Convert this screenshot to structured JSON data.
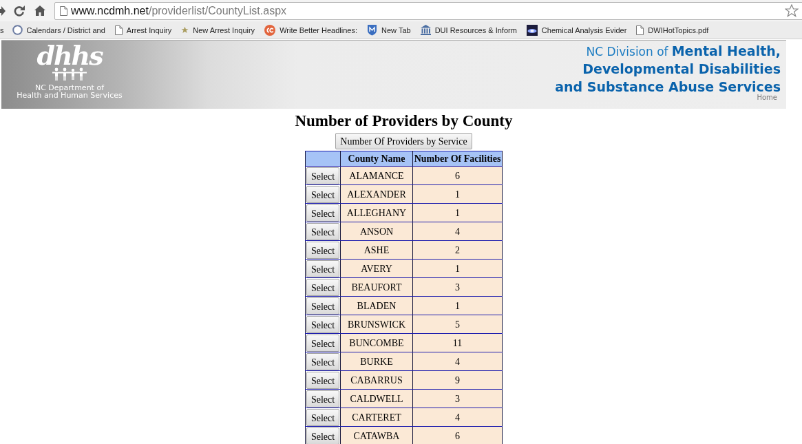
{
  "browser": {
    "address_bar": {
      "domain": "www.ncdmh.net",
      "path": "/providerlist/CountyList.aspx"
    },
    "bookmarks": [
      {
        "label": "s",
        "kind": "text"
      },
      {
        "label": "Calendars / District and",
        "kind": "ring"
      },
      {
        "label": "Arrest Inquiry",
        "kind": "page"
      },
      {
        "label": "New Arrest Inquiry",
        "kind": "star"
      },
      {
        "label": "Write Better Headlines:",
        "kind": "disc"
      },
      {
        "label": "New Tab",
        "kind": "shield"
      },
      {
        "label": "DUI Resources & Inform",
        "kind": "building"
      },
      {
        "label": "Chemical Analysis Evider",
        "kind": "image"
      },
      {
        "label": "DWIHotTopics.pdf",
        "kind": "page"
      }
    ]
  },
  "banner": {
    "logo": {
      "wordmark": "dhhs",
      "caption": [
        "NC Department of",
        "Health and Human Services"
      ]
    },
    "division": {
      "prefix": "NC Division of",
      "lines": [
        "Mental Health,",
        "Developmental Disabilities",
        "and Substance Abuse Services"
      ]
    },
    "home_link": "Home"
  },
  "page": {
    "title": "Number of Providers by County",
    "service_button": "Number Of Providers by Service"
  },
  "table": {
    "columns": [
      "County Name",
      "Number Of Facilities"
    ],
    "rows": [
      {
        "action": "Select",
        "county": "ALAMANCE",
        "facilities": "6"
      },
      {
        "action": "Select",
        "county": "ALEXANDER",
        "facilities": "1"
      },
      {
        "action": "Select",
        "county": "ALLEGHANY",
        "facilities": "1"
      },
      {
        "action": "Select",
        "county": "ANSON",
        "facilities": "4"
      },
      {
        "action": "Select",
        "county": "ASHE",
        "facilities": "2"
      },
      {
        "action": "Select",
        "county": "AVERY",
        "facilities": "1"
      },
      {
        "action": "Select",
        "county": "BEAUFORT",
        "facilities": "3"
      },
      {
        "action": "Select",
        "county": "BLADEN",
        "facilities": "1"
      },
      {
        "action": "Select",
        "county": "BRUNSWICK",
        "facilities": "5"
      },
      {
        "action": "Select",
        "county": "BUNCOMBE",
        "facilities": "11"
      },
      {
        "action": "Select",
        "county": "BURKE",
        "facilities": "4"
      },
      {
        "action": "Select",
        "county": "CABARRUS",
        "facilities": "9"
      },
      {
        "action": "Select",
        "county": "CALDWELL",
        "facilities": "3"
      },
      {
        "action": "Select",
        "county": "CARTERET",
        "facilities": "4"
      },
      {
        "action": "Select",
        "county": "CATAWBA",
        "facilities": "6"
      }
    ]
  }
}
